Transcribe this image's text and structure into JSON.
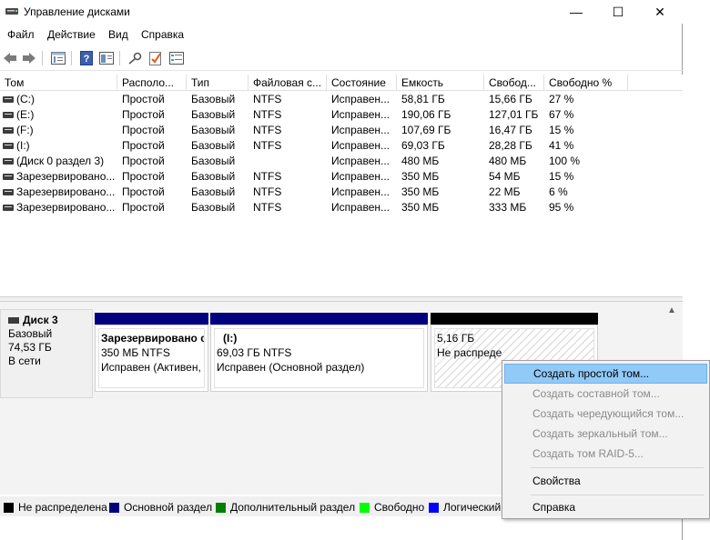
{
  "window": {
    "title": "Управление дисками",
    "controls": {
      "minimize": "—",
      "maximize": "☐",
      "close": "✕"
    }
  },
  "menu": [
    "Файл",
    "Действие",
    "Вид",
    "Справка"
  ],
  "toolbar": {
    "icons": [
      "back-arrow-icon",
      "forward-arrow-icon",
      "properties-view-icon",
      "help-icon",
      "console-view-icon",
      "key-icon",
      "checklist-icon",
      "list-view-icon"
    ]
  },
  "volumes": {
    "columns": [
      "Том",
      "Располо...",
      "Тип",
      "Файловая с...",
      "Состояние",
      "Емкость",
      "Свобод...",
      "Свободно %"
    ],
    "rows": [
      [
        "(C:)",
        "Простой",
        "Базовый",
        "NTFS",
        "Исправен...",
        "58,81 ГБ",
        "15,66 ГБ",
        "27 %"
      ],
      [
        "(E:)",
        "Простой",
        "Базовый",
        "NTFS",
        "Исправен...",
        "190,06 ГБ",
        "127,01 ГБ",
        "67 %"
      ],
      [
        "(F:)",
        "Простой",
        "Базовый",
        "NTFS",
        "Исправен...",
        "107,69 ГБ",
        "16,47 ГБ",
        "15 %"
      ],
      [
        "(I:)",
        "Простой",
        "Базовый",
        "NTFS",
        "Исправен...",
        "69,03 ГБ",
        "28,28 ГБ",
        "41 %"
      ],
      [
        "(Диск 0 раздел 3)",
        "Простой",
        "Базовый",
        "",
        "Исправен...",
        "480 МБ",
        "480 МБ",
        "100 %"
      ],
      [
        "Зарезервировано...",
        "Простой",
        "Базовый",
        "NTFS",
        "Исправен...",
        "350 МБ",
        "54 МБ",
        "15 %"
      ],
      [
        "Зарезервировано...",
        "Простой",
        "Базовый",
        "NTFS",
        "Исправен...",
        "350 МБ",
        "22 МБ",
        "6 %"
      ],
      [
        "Зарезервировано...",
        "Простой",
        "Базовый",
        "NTFS",
        "Исправен...",
        "350 МБ",
        "333 МБ",
        "95 %"
      ]
    ]
  },
  "disk": {
    "name": "Диск 3",
    "type": "Базовый",
    "size": "74,53 ГБ",
    "status": "В сети",
    "partitions": [
      {
        "name": "Зарезервировано с",
        "line2": "350 МБ NTFS",
        "line3": "Исправен (Активен,",
        "header_color": "#00007f"
      },
      {
        "name": "(I:)",
        "line2": "69,03 ГБ NTFS",
        "line3": "Исправен (Основной раздел)",
        "header_color": "#00007f"
      },
      {
        "name": "",
        "line2": "5,16 ГБ",
        "line3": "Не распреде",
        "header_color": "#000000"
      }
    ]
  },
  "legend": [
    {
      "label": "Не распределена",
      "color": "#000000"
    },
    {
      "label": "Основной раздел",
      "color": "#00007f"
    },
    {
      "label": "Дополнительный раздел",
      "color": "#007f00"
    },
    {
      "label": "Свободно",
      "color": "#00ff00"
    },
    {
      "label": "Логический",
      "color": "#0000ff"
    }
  ],
  "context_menu": {
    "items": [
      {
        "label": "Создать простой том...",
        "state": "highlighted"
      },
      {
        "label": "Создать составной том...",
        "state": "disabled"
      },
      {
        "label": "Создать чередующийся том...",
        "state": "disabled"
      },
      {
        "label": "Создать зеркальный том...",
        "state": "disabled"
      },
      {
        "label": "Создать том RAID-5...",
        "state": "disabled"
      },
      {
        "label": "Свойства",
        "state": "enabled"
      },
      {
        "label": "Справка",
        "state": "enabled"
      }
    ]
  }
}
